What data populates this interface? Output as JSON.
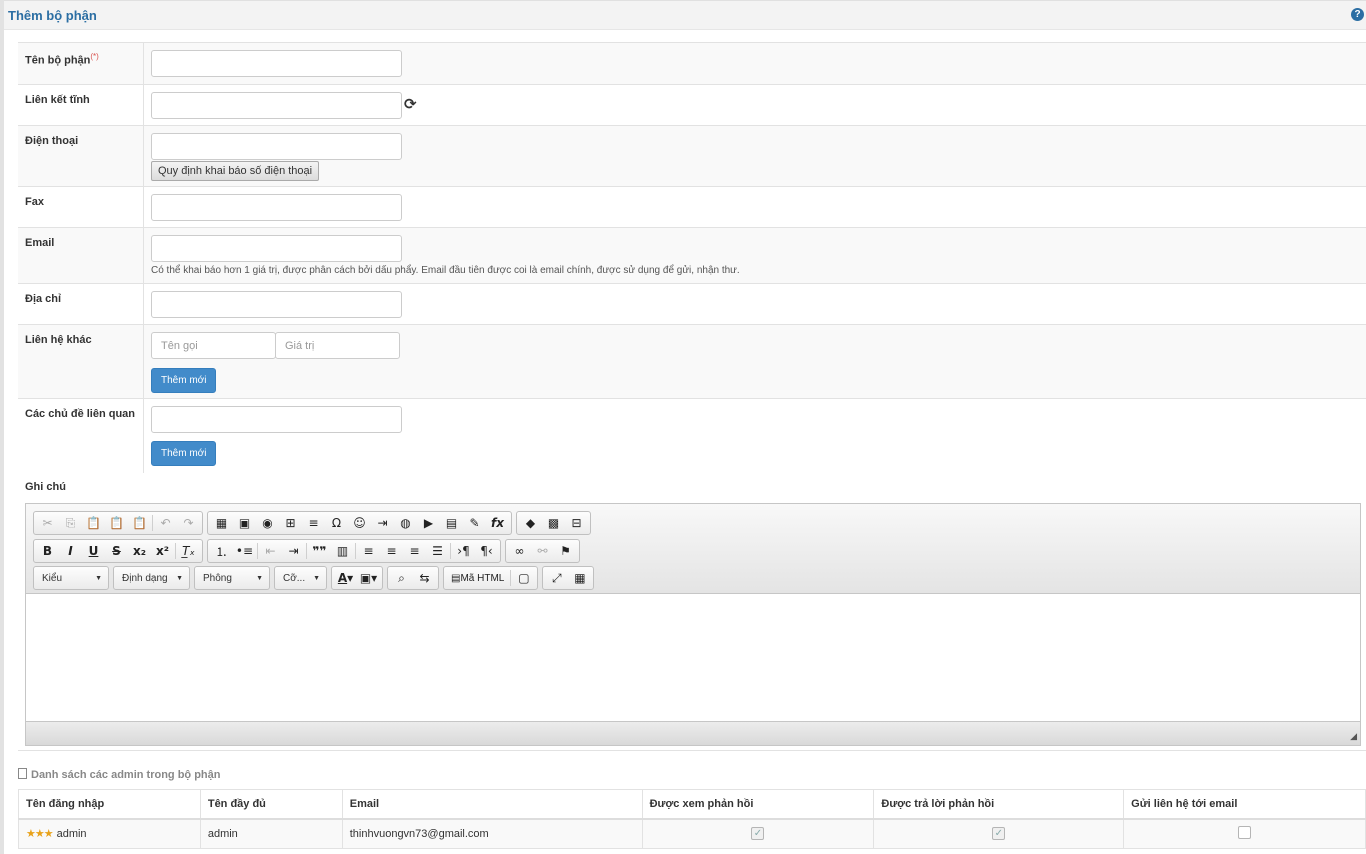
{
  "header": {
    "title": "Thêm bộ phận",
    "help_icon": "help-circle-icon"
  },
  "form": {
    "department_name": {
      "label": "Tên bộ phận",
      "required_mark": "(*)",
      "value": ""
    },
    "static_link": {
      "label": "Liên kết tĩnh",
      "value": "",
      "refresh_icon": "refresh-icon"
    },
    "phone": {
      "label": "Điện thoại",
      "value": "",
      "rules_button": "Quy định khai báo số điện thoại"
    },
    "fax": {
      "label": "Fax",
      "value": ""
    },
    "email": {
      "label": "Email",
      "value": "",
      "help": "Có thể khai báo hơn 1 giá trị, được phân cách bởi dấu phẩy. Email đầu tiên được coi là email chính, được sử dụng để gửi, nhận thư."
    },
    "address": {
      "label": "Địa chỉ",
      "value": ""
    },
    "other_contacts": {
      "label": "Liên hệ khác",
      "name_placeholder": "Tên gọi",
      "value_placeholder": "Giá trị",
      "add_button": "Thêm mới"
    },
    "topics": {
      "label": "Các chủ đề liên quan",
      "value": "",
      "add_button": "Thêm mới"
    },
    "notes": {
      "label": "Ghi chú"
    }
  },
  "editor": {
    "combos": {
      "style": "Kiểu",
      "format": "Định dạng",
      "font": "Phông",
      "size": "Cỡ..."
    },
    "source_label": "Mã HTML",
    "content": ""
  },
  "admins": {
    "section_title": "Danh sách các admin trong bộ phận",
    "columns": [
      "Tên đăng nhập",
      "Tên đầy đủ",
      "Email",
      "Được xem phản hồi",
      "Được trả lời phản hồi",
      "Gửi liên hệ tới email"
    ],
    "rows": [
      {
        "username": "admin",
        "fullname": "admin",
        "email": "thinhvuongvn73@gmail.com",
        "can_view": true,
        "can_reply": true,
        "send_email": false
      }
    ]
  }
}
